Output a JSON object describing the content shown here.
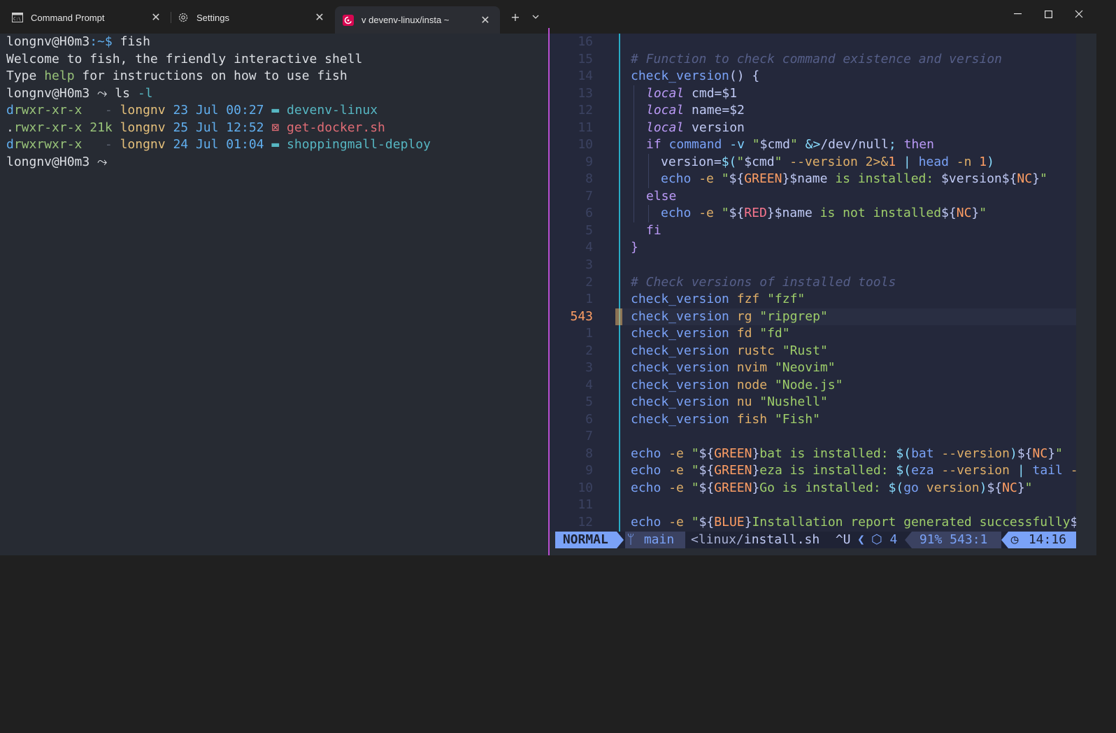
{
  "tabs": [
    {
      "label": "Command Prompt",
      "icon": "cmd-icon"
    },
    {
      "label": "Settings",
      "icon": "gear-icon"
    },
    {
      "label": "v devenv-linux/insta ~",
      "icon": "debian-icon"
    }
  ],
  "titlebar": {
    "new_tab": "+",
    "dropdown": "⌄",
    "minimize": "—",
    "maximize": "☐",
    "close": "✕"
  },
  "left_terminal": {
    "prompt1_user": "longnv@H0m3",
    "prompt1_path": ":~$",
    "prompt1_cmd": " fish",
    "welcome": "Welcome to fish, the friendly interactive shell",
    "help_pre": "Type ",
    "help_word": "help",
    "help_post": " for instructions on how to use fish",
    "prompt_user": "longnv@H0m3",
    "prompt_arrow": " ⤳ ",
    "cmd_ls": "ls",
    "cmd_ls_flag": " -l",
    "listing": [
      {
        "perm_d": "d",
        "perm": "rwxr-xr-x",
        "size": "   -",
        "owner": " longnv",
        "date": " 23 Jul 00:27",
        "icon": " ▬ ",
        "name": "devenv-linux",
        "kind": "dir"
      },
      {
        "perm_d": ".",
        "perm": "rwxr-xr-x",
        "size": " 21k",
        "owner": " longnv",
        "date": " 25 Jul 12:52",
        "icon": " ⊠ ",
        "name": "get-docker.sh",
        "kind": "script"
      },
      {
        "perm_d": "d",
        "perm": "rwxrwxr-x",
        "size": "   -",
        "owner": " longnv",
        "date": " 24 Jul 01:04",
        "icon": " ▬ ",
        "name": "shoppingmall-deploy",
        "kind": "dir"
      }
    ]
  },
  "editor": {
    "gutter": [
      "16",
      "15",
      "14",
      "13",
      "12",
      "11",
      "10",
      "9",
      "8",
      "7",
      "6",
      "5",
      "4",
      "3",
      "2",
      "1",
      "543",
      "1",
      "2",
      "3",
      "4",
      "5",
      "6",
      "7",
      "8",
      "9",
      "10",
      "11",
      "12"
    ],
    "current_line": "543",
    "code": {
      "l15": "# Function to check command existence and version",
      "l14_fn": "check_version",
      "l14_rest": "() {",
      "l13_kw": "local",
      "l13_rest": " cmd=$1",
      "l12_kw": "local",
      "l12_rest": " name=$2",
      "l11_kw": "local",
      "l11_rest": " version",
      "l2": "# Check versions of installed tools",
      "calls": [
        {
          "fn": "check_version",
          "arg": " fzf",
          "str": " \"fzf\""
        },
        {
          "fn": "check_version",
          "arg": " rg",
          "str": " \"ripgrep\""
        },
        {
          "fn": "check_version",
          "arg": " fd",
          "str": " \"fd\""
        },
        {
          "fn": "check_version",
          "arg": " rustc",
          "str": " \"Rust\""
        },
        {
          "fn": "check_version",
          "arg": " nvim",
          "str": " \"Neovim\""
        },
        {
          "fn": "check_version",
          "arg": " node",
          "str": " \"Node.js\""
        },
        {
          "fn": "check_version",
          "arg": " nu",
          "str": " \"Nushell\""
        },
        {
          "fn": "check_version",
          "arg": " fish",
          "str": " \"Fish\""
        }
      ]
    }
  },
  "statusline": {
    "mode": " NORMAL ",
    "branch_icon": "",
    "branch": " main ",
    "file_prefix": "<linux/",
    "file_name": "install.sh",
    "flags": " ^U ",
    "lsp_icon": "⬡",
    "lsp_count": " 4 ",
    "progress": " 91% 543:1 ",
    "clock_icon": "◷",
    "time": " 14:16 "
  },
  "colors": {
    "accent_split": "#b84fd0",
    "mode_bg": "#7aa2f7",
    "editor_bg": "#24283b",
    "terminal_bg": "#272b33"
  }
}
